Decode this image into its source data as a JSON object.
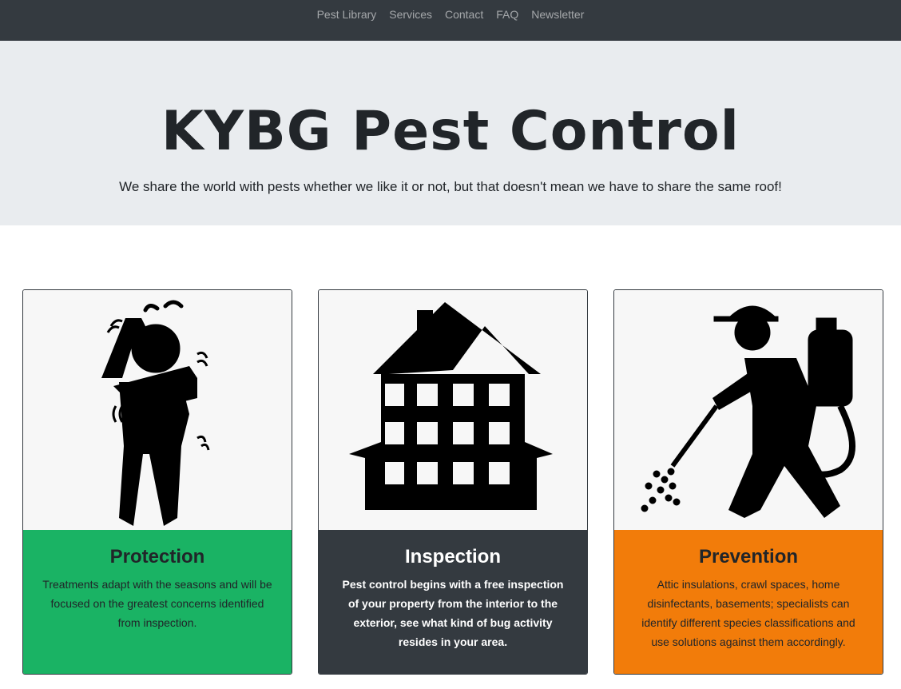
{
  "nav": {
    "items": [
      {
        "label": "Pest Library"
      },
      {
        "label": "Services"
      },
      {
        "label": "Contact"
      },
      {
        "label": "FAQ"
      },
      {
        "label": "Newsletter"
      }
    ]
  },
  "hero": {
    "title": "KYBG Pest Control",
    "subtitle": "We share the world with pests whether we like it or not, but that doesn't mean we have to share the same roof!"
  },
  "cards": [
    {
      "icon": "scratching-person-icon",
      "title": "Protection",
      "text": "Treatments adapt with the seasons and will be focused on the greatest concerns identified from inspection.",
      "color": "#1ab364"
    },
    {
      "icon": "house-icon",
      "title": "Inspection",
      "text": "Pest control begins with a free inspection of your property from the interior to the exterior, see what kind of bug activity resides in your area.",
      "color": "#343a40"
    },
    {
      "icon": "exterminator-sprayer-icon",
      "title": "Prevention",
      "text": "Attic insulations, crawl spaces, home disinfectants, basements; specialists can identify different species classifications and use solutions against them accordingly.",
      "color": "#f27c0a"
    }
  ]
}
